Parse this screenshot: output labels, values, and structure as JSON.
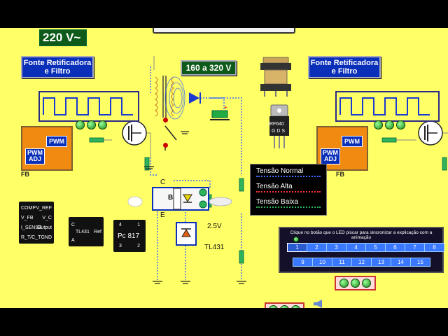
{
  "input_voltage": "220 V~",
  "left": {
    "rectifier": "Fonte Retificadora e Filtro",
    "pwm": "PWM",
    "pwm_adj": "PWM ADJ",
    "fb": "FB"
  },
  "right": {
    "rectifier": "Fonte Retificadora e Filtro",
    "pwm": "PWM",
    "pwm_adj": "PWM ADJ",
    "fb": "FB"
  },
  "output_range": "160 a 320 V",
  "transistor_name": "IRF640",
  "transistor_pins": "G D S",
  "optocoupler": {
    "c": "C",
    "b": "B",
    "e": "E"
  },
  "zener_voltage": "2.5V",
  "zener_name": "TL431",
  "comp_ic_pins": [
    "COMP",
    "V_REF",
    "V_FB",
    "V_C",
    "I_SENSE",
    "Output",
    "R_T/C_T",
    "GND"
  ],
  "tl431_ic": {
    "c": "C",
    "a": "A",
    "name": "TL431",
    "ref": "Ref"
  },
  "pc817": {
    "name": "Pc 817",
    "pins": [
      "4",
      "1",
      "3",
      "2"
    ]
  },
  "legend": {
    "normal": "Tensão Normal",
    "alta": "Tensão Alta",
    "baixa": "Tensão Baixa",
    "colors": {
      "normal": "#3c6cff",
      "alta": "#ff3030",
      "baixa": "#2fb35a"
    }
  },
  "sync_hint": "Clique no botão que o LED piscar para sincronizar a explicação com a animação",
  "steps_row1": [
    "1",
    "2",
    "3",
    "4",
    "5",
    "6",
    "7",
    "8"
  ],
  "steps_row2": [
    "9",
    "10",
    "11",
    "12",
    "13",
    "14",
    "15"
  ],
  "selected_step": "1"
}
